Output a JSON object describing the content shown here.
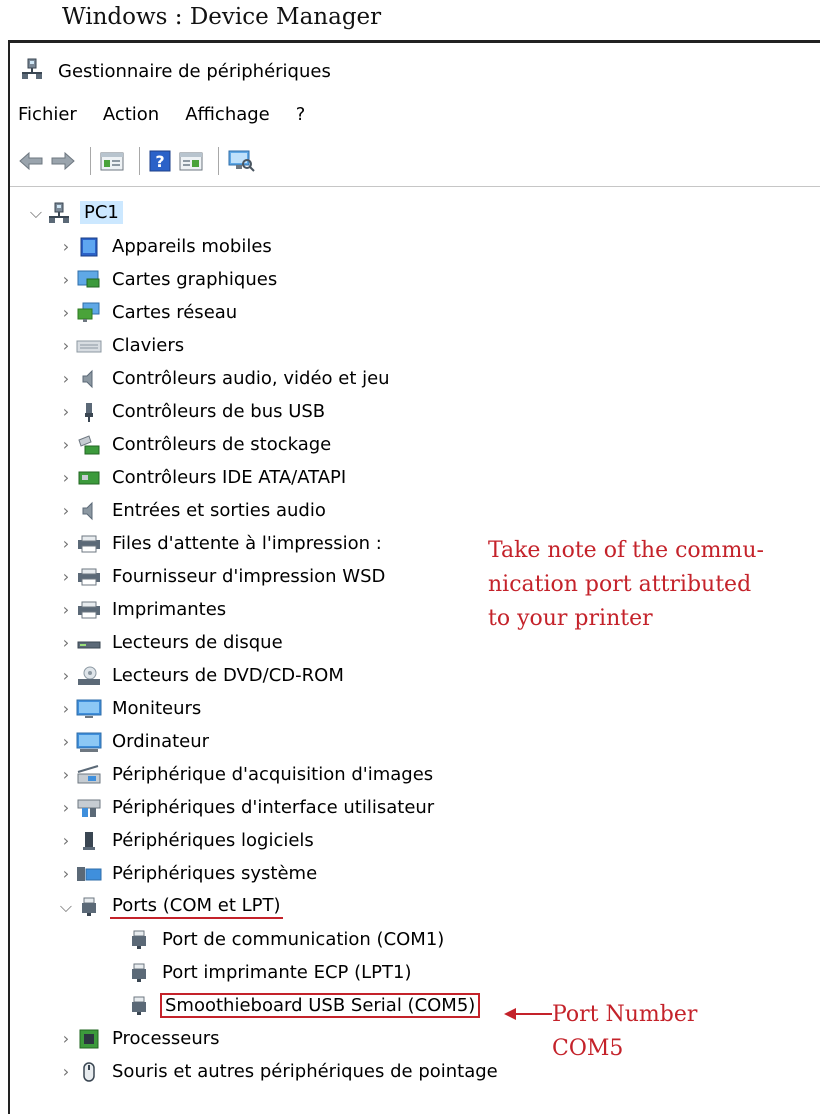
{
  "caption": "Windows : Device Manager",
  "window": {
    "title": "Gestionnaire de périphériques"
  },
  "menu": [
    "Fichier",
    "Action",
    "Affichage",
    "?"
  ],
  "toolbar": [
    "back-icon",
    "forward-icon",
    "properties-icon",
    "help-icon",
    "update-driver-icon",
    "scan-hardware-icon"
  ],
  "tree": {
    "root": "PC1",
    "categories": [
      "Appareils mobiles",
      "Cartes graphiques",
      "Cartes réseau",
      "Claviers",
      "Contrôleurs audio, vidéo et jeu",
      "Contrôleurs de bus USB",
      "Contrôleurs de stockage",
      "Contrôleurs IDE ATA/ATAPI",
      "Entrées et sorties audio",
      "Files d'attente à l'impression :",
      "Fournisseur d'impression WSD",
      "Imprimantes",
      "Lecteurs de disque",
      "Lecteurs de DVD/CD-ROM",
      "Moniteurs",
      "Ordinateur",
      "Périphérique d'acquisition d'images",
      "Périphériques d'interface utilisateur",
      "Périphériques logiciels",
      "Périphériques système"
    ],
    "ports_label": "Ports (COM et LPT)",
    "ports": [
      "Port de communication (COM1)",
      "Port imprimante ECP (LPT1)",
      "Smoothieboard USB Serial (COM5)"
    ],
    "after": [
      "Processeurs",
      "Souris et autres périphériques de pointage"
    ]
  },
  "annotations": {
    "note_lines": [
      "Take note of the commu-",
      "nication port attributed",
      "to your printer"
    ],
    "port_lines": [
      "Port Number",
      "COM5"
    ]
  },
  "colors": {
    "accent": "#c4222a",
    "selection": "#cce8ff"
  }
}
